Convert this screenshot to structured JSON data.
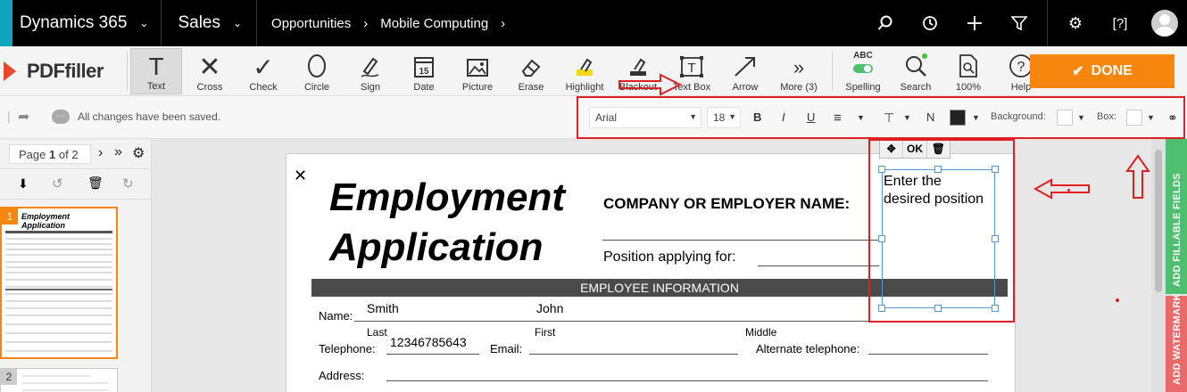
{
  "topnav": {
    "brand": "Dynamics 365",
    "area": "Sales",
    "breadcrumbs": [
      "Opportunities",
      "Mobile Computing"
    ]
  },
  "toolbar": {
    "logo": "PDFfiller",
    "tools": [
      {
        "label": "Text",
        "icon": "text-icon"
      },
      {
        "label": "Cross",
        "icon": "cross-icon"
      },
      {
        "label": "Check",
        "icon": "check-icon"
      },
      {
        "label": "Circle",
        "icon": "circle-icon"
      },
      {
        "label": "Sign",
        "icon": "sign-pen-icon"
      },
      {
        "label": "Date",
        "icon": "calendar-icon"
      },
      {
        "label": "Picture",
        "icon": "picture-icon"
      },
      {
        "label": "Erase",
        "icon": "eraser-icon"
      },
      {
        "label": "Highlight",
        "icon": "highlighter-icon"
      },
      {
        "label": "Blackout",
        "icon": "blackout-icon"
      },
      {
        "label": "Text Box",
        "icon": "text-box-icon"
      },
      {
        "label": "Arrow",
        "icon": "arrow-icon"
      },
      {
        "label": "More (3)",
        "icon": "more-icon"
      },
      {
        "label": "Spelling",
        "icon": "spelling-icon",
        "sub": "ABC"
      },
      {
        "label": "Search",
        "icon": "search-icon"
      },
      {
        "label": "100%",
        "icon": "zoom-icon"
      },
      {
        "label": "Help",
        "icon": "help-icon"
      }
    ],
    "done_label": "DONE"
  },
  "formatbar": {
    "saved_text": "All changes have been saved.",
    "font": "Arial",
    "size": "18",
    "bold": "B",
    "italic": "I",
    "underline": "U",
    "normal": "N",
    "background_label": "Background:",
    "box_label": "Box:"
  },
  "pager": {
    "prefix": "Page",
    "current": "1",
    "of": "of 2",
    "thumbs": [
      "1",
      "2"
    ]
  },
  "document": {
    "title_line1": "Employment",
    "title_line2": "Application",
    "company_label": "COMPANY OR EMPLOYER NAME:",
    "position_label": "Position applying for:",
    "section": "EMPLOYEE INFORMATION",
    "name_label": "Name:",
    "name_last": "Smith",
    "name_first": "John",
    "last_label": "Last",
    "first_label": "First",
    "middle_label": "Middle",
    "telephone_label": "Telephone:",
    "telephone_value": "12346785643",
    "email_label": "Email:",
    "alt_phone_label": "Alternate telephone:",
    "address_label": "Address:"
  },
  "textbox": {
    "ok_label": "OK",
    "content": "Enter the desired position"
  },
  "side_tabs": {
    "fillable": "ADD FILLABLE FIELDS",
    "watermark": "ADD WATERMARK"
  },
  "colors": {
    "accent": "#f7860e",
    "annotation_red": "#e02020",
    "selection_blue": "#5a95d2"
  }
}
